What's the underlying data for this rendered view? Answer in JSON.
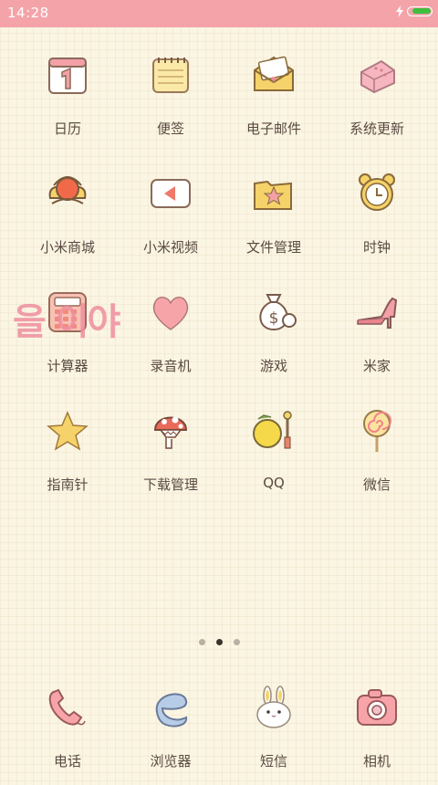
{
  "status_bar": {
    "time": "14:28",
    "battery_level": 0.85,
    "charging": true
  },
  "apps": [
    {
      "label": "日历",
      "icon": "calendar-icon"
    },
    {
      "label": "便签",
      "icon": "notepad-icon"
    },
    {
      "label": "电子邮件",
      "icon": "mail-icon"
    },
    {
      "label": "系统更新",
      "icon": "system-update-icon"
    },
    {
      "label": "小米商城",
      "icon": "mi-store-icon"
    },
    {
      "label": "小米视频",
      "icon": "video-icon"
    },
    {
      "label": "文件管理",
      "icon": "folder-icon"
    },
    {
      "label": "时钟",
      "icon": "clock-icon"
    },
    {
      "label": "计算器",
      "icon": "calculator-icon"
    },
    {
      "label": "录音机",
      "icon": "recorder-icon"
    },
    {
      "label": "游戏",
      "icon": "money-bag-icon"
    },
    {
      "label": "米家",
      "icon": "high-heel-icon"
    },
    {
      "label": "指南针",
      "icon": "star-icon"
    },
    {
      "label": "下载管理",
      "icon": "mushroom-icon"
    },
    {
      "label": "QQ",
      "icon": "qq-icon"
    },
    {
      "label": "微信",
      "icon": "lollipop-icon"
    }
  ],
  "overlay_text": "을 이야",
  "pager": {
    "pages": 3,
    "current": 2
  },
  "dock": [
    {
      "label": "电话",
      "icon": "phone-icon"
    },
    {
      "label": "浏览器",
      "icon": "browser-icon"
    },
    {
      "label": "短信",
      "icon": "bunny-icon"
    },
    {
      "label": "相机",
      "icon": "camera-icon"
    }
  ],
  "colors": {
    "status_bar": "#f4a3a9",
    "background": "#fbf5e3",
    "label_text": "#5a4a42",
    "accent_pink": "#f3a0a6",
    "accent_yellow": "#f5d36a"
  }
}
